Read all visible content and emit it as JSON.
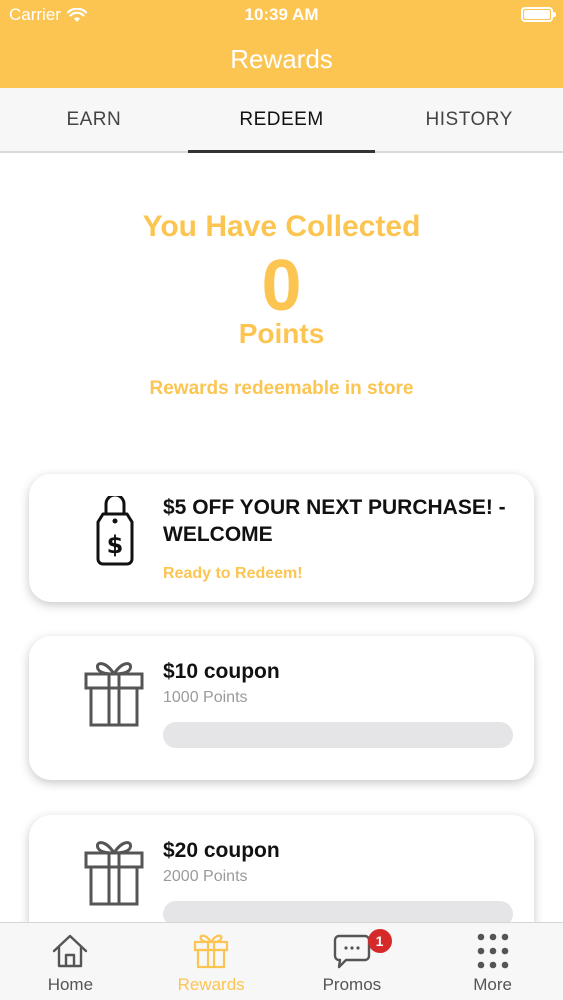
{
  "status_bar": {
    "carrier": "Carrier",
    "time": "10:39 AM"
  },
  "nav": {
    "title": "Rewards"
  },
  "tabs": [
    {
      "label": "EARN",
      "active": false
    },
    {
      "label": "REDEEM",
      "active": true
    },
    {
      "label": "HISTORY",
      "active": false
    }
  ],
  "summary": {
    "collected_label": "You Have Collected",
    "points": "0",
    "points_label": "Points",
    "redeemable": "Rewards redeemable in store"
  },
  "rewards": [
    {
      "icon": "price-tag-icon",
      "title": "$5 OFF YOUR NEXT PURCHASE! - WELCOME",
      "status": "Ready to Redeem!"
    },
    {
      "icon": "gift-icon",
      "title": "$10 coupon",
      "points": "1000 Points",
      "progress": 0
    },
    {
      "icon": "gift-icon",
      "title": "$20 coupon",
      "points": "2000 Points",
      "progress": 0
    }
  ],
  "tabbar": [
    {
      "label": "Home",
      "icon": "home-icon",
      "active": false
    },
    {
      "label": "Rewards",
      "icon": "gift-icon",
      "active": true
    },
    {
      "label": "Promos",
      "icon": "chat-bubble-icon",
      "badge": "1",
      "active": false
    },
    {
      "label": "More",
      "icon": "grid-dots-icon",
      "active": false
    }
  ],
  "colors": {
    "accent": "#fcc552",
    "badge": "#d62a2a",
    "text": "#111111"
  }
}
